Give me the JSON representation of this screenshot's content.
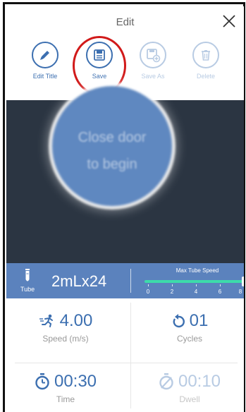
{
  "header": {
    "title": "Edit"
  },
  "toolbar": {
    "items": [
      {
        "label": "Edit Title",
        "icon": "pencil-icon",
        "enabled": true
      },
      {
        "label": "Save",
        "icon": "floppy-disk-icon",
        "enabled": true
      },
      {
        "label": "Save As",
        "icon": "floppy-disk-plus-icon",
        "enabled": false
      },
      {
        "label": "Delete",
        "icon": "trash-icon",
        "enabled": false
      }
    ],
    "highlighted": "Save"
  },
  "stage": {
    "line1": "Close door",
    "line2": "to begin"
  },
  "tube": {
    "label": "Tube",
    "value": "2mLx24",
    "max_speed_title": "Max Tube Speed",
    "ticks": [
      "0",
      "2",
      "4",
      "6",
      "8"
    ],
    "speed_value": 8
  },
  "stats": {
    "speed": {
      "value": "4.00",
      "caption": "Speed (m/s)",
      "icon": "runner-icon"
    },
    "cycles": {
      "value": "01",
      "caption": "Cycles",
      "icon": "repeat-icon"
    },
    "time": {
      "value": "00:30",
      "caption": "Time",
      "icon": "stopwatch-icon"
    },
    "dwell": {
      "value": "00:10",
      "caption": "Dwell",
      "icon": "stopwatch-off-icon"
    }
  },
  "colors": {
    "accent": "#3c6fb0",
    "disabled": "#b8cbe3",
    "stage_bg": "#2b3542",
    "tube_bar": "#5b82bd",
    "slider": "#3ddbaa",
    "highlight": "#d11a1a"
  }
}
